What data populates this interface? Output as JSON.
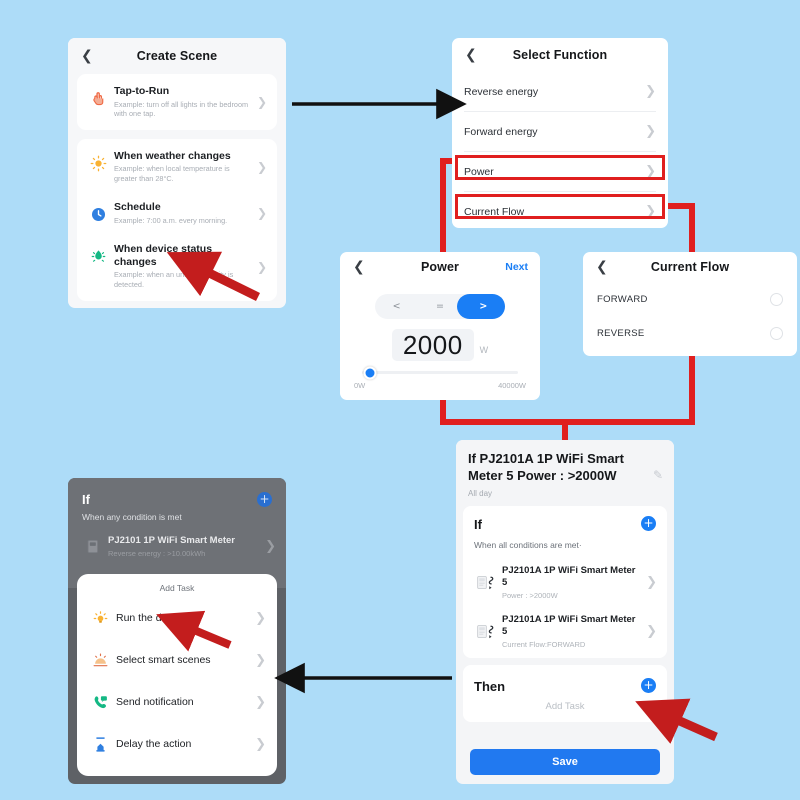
{
  "theme": {
    "background": "#ADDCF8",
    "accent_blue": "#1a7ef5",
    "highlight_red": "#e01f1f",
    "save_blue": "#2179f0"
  },
  "create_scene": {
    "title": "Create Scene",
    "back_icon": "chevron-left-icon",
    "items": [
      {
        "icon": "tap-hand-icon",
        "title": "Tap-to-Run",
        "subtitle": "Example: turn off all lights in the bedroom with one tap.",
        "chevron": "chevron-right-icon"
      },
      {
        "icon": "sun-icon",
        "title": "When weather changes",
        "subtitle": "Example: when local temperature is greater than 28°C.",
        "chevron": "chevron-right-icon"
      },
      {
        "icon": "clock-icon",
        "title": "Schedule",
        "subtitle": "Example: 7:00 a.m. every morning.",
        "chevron": "chevron-right-icon"
      },
      {
        "icon": "sensor-icon",
        "title": "When device status changes",
        "subtitle": "Example: when an unusual activity is detected.",
        "chevron": "chevron-right-icon"
      }
    ]
  },
  "select_function": {
    "title": "Select Function",
    "back_icon": "chevron-left-icon",
    "rows": [
      {
        "label": "Reverse energy",
        "highlighted": false
      },
      {
        "label": "Forward energy",
        "highlighted": false
      },
      {
        "label": "Power",
        "highlighted": true
      },
      {
        "label": "Current Flow",
        "highlighted": true
      }
    ]
  },
  "power_panel": {
    "title": "Power",
    "back_icon": "chevron-left-icon",
    "next_label": "Next",
    "comparators": [
      "<",
      "=",
      ">"
    ],
    "selected_comparator": ">",
    "value": "2000",
    "unit": "W",
    "slider": {
      "min_label": "0W",
      "max_label": "40000W",
      "percent": 5
    }
  },
  "current_flow_panel": {
    "title": "Current Flow",
    "back_icon": "chevron-left-icon",
    "options": [
      {
        "label": "FORWARD",
        "selected": false
      },
      {
        "label": "REVERSE",
        "selected": false
      }
    ]
  },
  "scene_detail": {
    "title": "If PJ2101A 1P WiFi Smart Meter  5 Power : >2000W",
    "schedule": "All day",
    "edit_icon": "pencil-icon",
    "if_section": {
      "heading": "If",
      "add_icon": "plus-circle-icon",
      "subtitle": "When all conditions are met·",
      "conditions": [
        {
          "icon": "smart-meter-icon",
          "name": "PJ2101A 1P WiFi Smart Meter 5",
          "state": "Power : >2000W",
          "chevron": "chevron-right-icon"
        },
        {
          "icon": "smart-meter-icon",
          "name": "PJ2101A 1P WiFi Smart Meter 5",
          "state": "Current Flow:FORWARD",
          "chevron": "chevron-right-icon"
        }
      ]
    },
    "then_section": {
      "heading": "Then",
      "add_icon": "plus-circle-icon",
      "add_task_label": "Add Task"
    },
    "save_label": "Save"
  },
  "add_task_phone": {
    "if_heading": "If",
    "add_icon": "plus-circle-icon",
    "if_subtitle": "When any condition is met",
    "device": {
      "icon": "smart-meter-icon",
      "name": "PJ2101 1P WiFi Smart Meter",
      "state": "Reverse energy : >10.00kWh",
      "chevron": "chevron-right-icon"
    },
    "sheet_title": "Add Task",
    "tasks": [
      {
        "icon": "bulb-icon",
        "label": "Run the device",
        "chevron": "chevron-right-icon"
      },
      {
        "icon": "scenes-icon",
        "label": "Select smart scenes",
        "chevron": "chevron-right-icon"
      },
      {
        "icon": "phone-message-icon",
        "label": "Send notification",
        "chevron": "chevron-right-icon"
      },
      {
        "icon": "hourglass-icon",
        "label": "Delay the action",
        "chevron": "chevron-right-icon"
      }
    ]
  },
  "annotations": {
    "flow_arrows": [
      {
        "name": "arrow-create-scene-to-select-function",
        "direction": "right"
      },
      {
        "name": "arrow-scene-detail-to-add-task",
        "direction": "left"
      }
    ],
    "callout_arrows": [
      {
        "name": "callout-when-device-status-changes"
      },
      {
        "name": "callout-then-add-button"
      }
    ]
  }
}
